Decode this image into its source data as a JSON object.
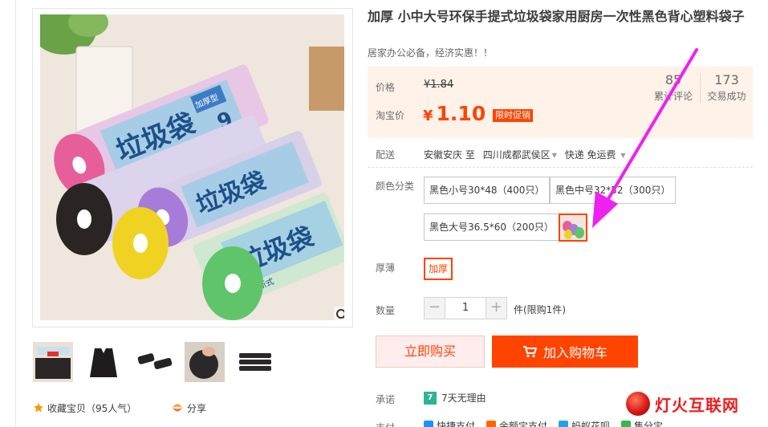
{
  "product": {
    "title": "加厚 小中大号环保手提式垃圾袋家用厨房一次性黑色背心塑料袋子",
    "subtitle": "居家办公必备，经济实惠！！"
  },
  "price": {
    "label": "价格",
    "original": "¥1.84",
    "taobao_label": "淘宝价",
    "currency": "¥",
    "current": "1.10",
    "promo_tag": "限时促销"
  },
  "stats": [
    {
      "value": "85",
      "label": "累计评论"
    },
    {
      "value": "173",
      "label": "交易成功"
    }
  ],
  "delivery": {
    "label": "配送",
    "from": "安徽安庆",
    "to_word": "至",
    "to": "四川成都武侯区",
    "method": "快递",
    "fee": "免运费"
  },
  "color": {
    "label": "颜色分类",
    "options": [
      "黑色小号30*48（400只）",
      "黑色中号32*52（300只）",
      "黑色大号36.5*60（200只）"
    ]
  },
  "thickness": {
    "label": "厚薄",
    "option": "加厚"
  },
  "quantity": {
    "label": "数量",
    "minus": "−",
    "value": "1",
    "plus": "+",
    "note": "件(限购1件)"
  },
  "actions": {
    "buy_now": "立即购买",
    "add_cart": "加入购物车"
  },
  "promise": {
    "label": "承诺",
    "badge": "7",
    "text": "7天无理由"
  },
  "payment": {
    "label": "支付",
    "methods": [
      "快捷支付",
      "余额宝支付",
      "蚂蚁花呗",
      "集分宝"
    ]
  },
  "gallery": {
    "favorite": "收藏宝贝（95人气）",
    "share": "分享"
  },
  "watermark": "灯火互联网",
  "package_text": {
    "big": "垃圾袋",
    "type": "加厚型",
    "spec": "点断式",
    "count": "9"
  },
  "colors": {
    "accent": "#ff4400",
    "price_bg": "#fff2e8",
    "arrow": "#ee22ee"
  }
}
